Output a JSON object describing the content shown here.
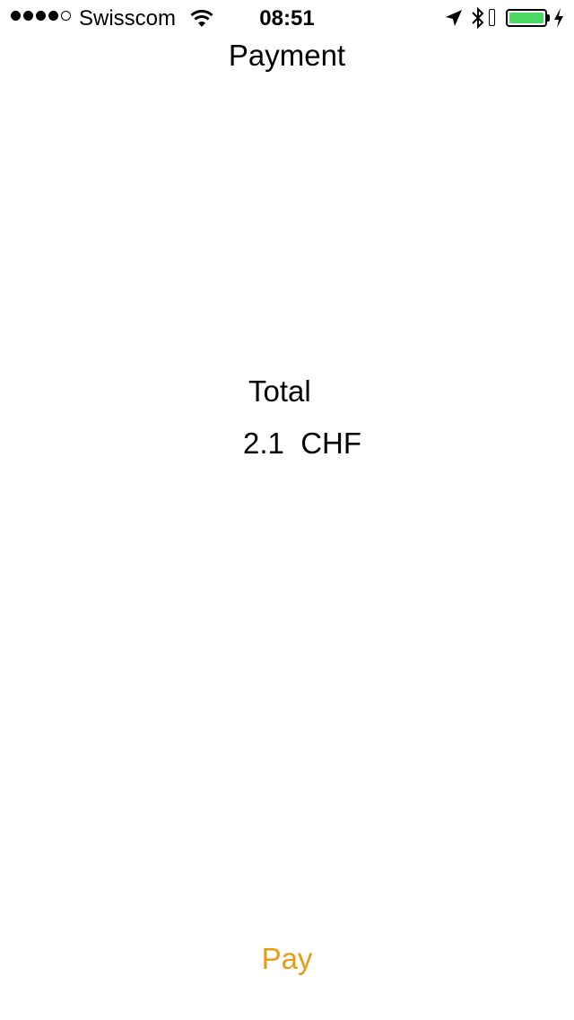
{
  "status_bar": {
    "signal_bars_filled": 4,
    "signal_bars_total": 5,
    "carrier": "Swisscom",
    "time": "08:51",
    "battery_level": 1.0,
    "battery_color": "#4cd964",
    "icons": [
      "wifi-icon",
      "location-icon",
      "bluetooth-icon",
      "battery-icon",
      "charging-icon"
    ]
  },
  "nav": {
    "title": "Payment"
  },
  "summary": {
    "total_label": "Total",
    "amount": "2.1",
    "currency": "CHF"
  },
  "actions": {
    "pay_label": "Pay",
    "accent_color": "#e69b12"
  }
}
